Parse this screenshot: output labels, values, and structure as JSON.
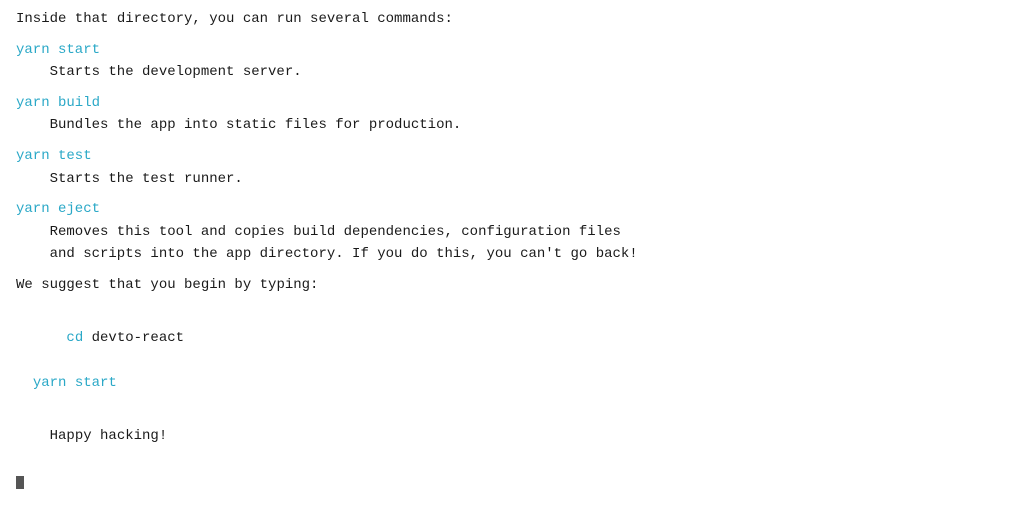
{
  "content": {
    "intro_line": "Inside that directory, you can run several commands:",
    "commands": [
      {
        "cmd": "yarn start",
        "description": "  Starts the development server."
      },
      {
        "cmd": "yarn build",
        "description": "  Bundles the app into static files for production."
      },
      {
        "cmd": "yarn test",
        "description": "  Starts the test runner."
      },
      {
        "cmd": "yarn eject",
        "description_line1": "  Removes this tool and copies build dependencies, configuration files",
        "description_line2": "  and scripts into the app directory. If you do this, you can't go back!"
      }
    ],
    "suggest_line": "We suggest that you begin by typing:",
    "suggest_cmd1": "cd devto-react",
    "suggest_cmd2": "yarn start",
    "closing": "Happy hacking!"
  }
}
